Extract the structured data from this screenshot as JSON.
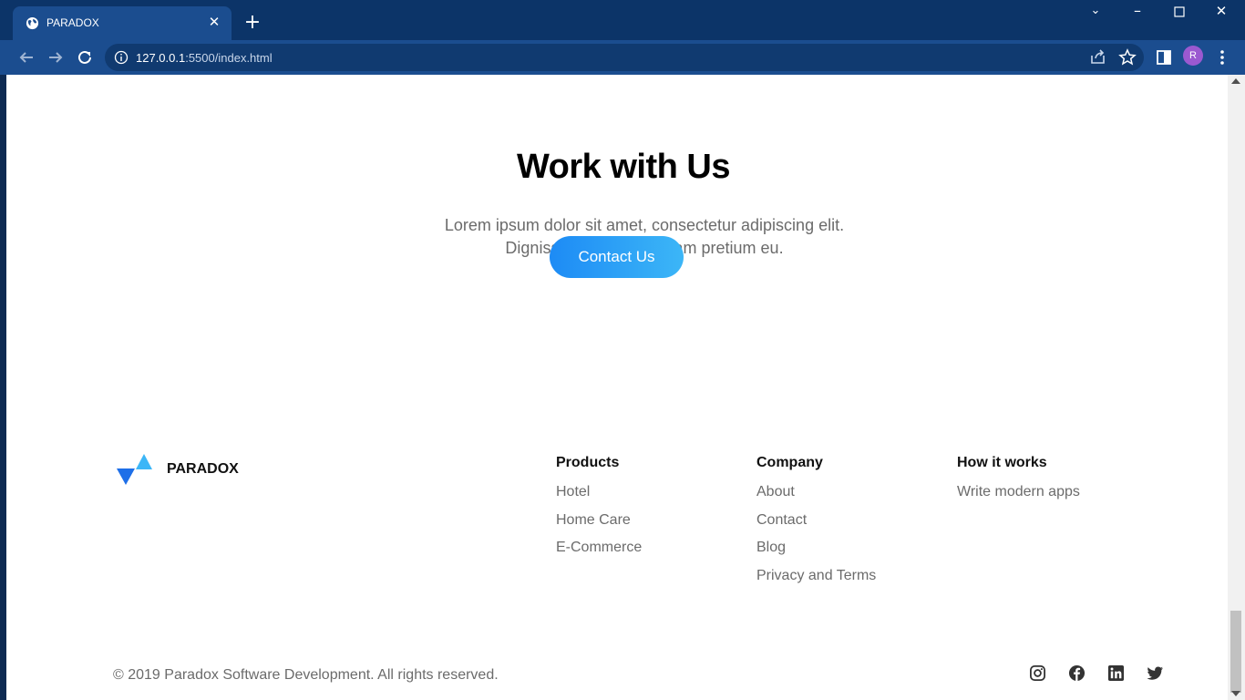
{
  "browser": {
    "tab_title": "PARADOX",
    "url_host": "127.0.0.1",
    "url_path": ":5500/index.html",
    "profile_initial": "R"
  },
  "hero": {
    "title": "Work with Us",
    "subtitle_line1": "Lorem ipsum dolor sit amet, consectetur adipiscing elit.",
    "subtitle_line2": "Dignissim nulla nibh quam pretium eu.",
    "cta_label": "Contact Us"
  },
  "footer": {
    "brand_name": "PARADOX",
    "columns": [
      {
        "heading": "Products",
        "links": [
          "Hotel",
          "Home Care",
          "E-Commerce"
        ]
      },
      {
        "heading": "Company",
        "links": [
          "About",
          "Contact",
          "Blog",
          "Privacy and Terms"
        ]
      },
      {
        "heading": "How it works",
        "links": [
          "Write modern apps"
        ]
      }
    ],
    "copyright": "© 2019 Paradox Software Development. All rights reserved.",
    "social_icons": [
      "instagram-icon",
      "facebook-icon",
      "linkedin-icon",
      "twitter-icon"
    ]
  },
  "colors": {
    "accent_start": "#1d8bf5",
    "accent_end": "#3cb6f7",
    "chrome": "#1b4d8f"
  }
}
